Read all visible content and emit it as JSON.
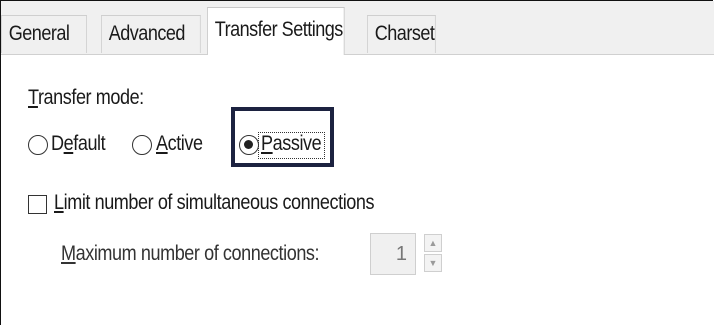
{
  "tabs": [
    {
      "label": "General",
      "active": false
    },
    {
      "label": "Advanced",
      "active": false
    },
    {
      "label": "Transfer Settings",
      "active": true
    },
    {
      "label": "Charset",
      "active": false
    }
  ],
  "transfer_mode": {
    "label": "Transfer mode:",
    "options": [
      {
        "label": "Default",
        "checked": false
      },
      {
        "label": "Active",
        "checked": false
      },
      {
        "label": "Passive",
        "checked": true
      }
    ]
  },
  "limit_connections": {
    "label": "Limit number of simultaneous connections",
    "checked": false
  },
  "max_connections": {
    "label": "Maximum number of connections:",
    "value": "1",
    "enabled": false
  },
  "colors": {
    "highlight_box": "#1c2240",
    "tab_background": "#f0f0f0",
    "content_background": "#ffffff"
  },
  "icons": {
    "spin_up": "spin-up-arrow-icon",
    "spin_down": "spin-down-arrow-icon"
  }
}
